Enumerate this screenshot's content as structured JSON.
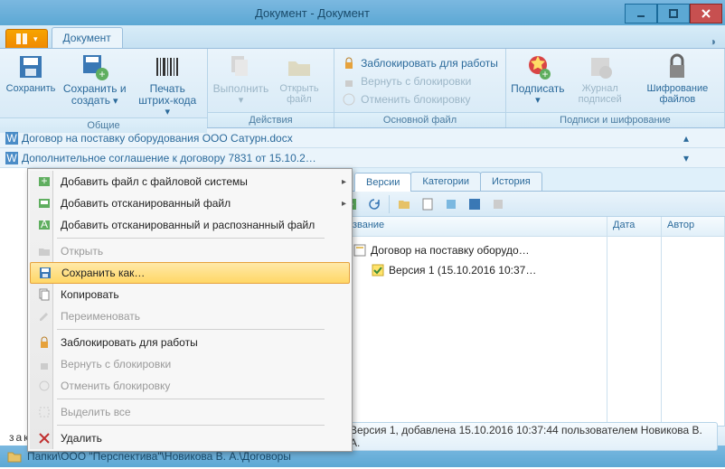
{
  "window": {
    "title": "Документ - Документ"
  },
  "menu": {
    "box": "",
    "doc_tab": "Документ"
  },
  "ribbon": {
    "group_general": "Общие",
    "group_actions": "Действия",
    "group_mainfile": "Основной файл",
    "group_signs": "Подписи и шифрование",
    "save": "Сохранить",
    "save_create": "Сохранить\nи создать",
    "barcode": "Печать\nштрих-кода",
    "execute": "Выполнить",
    "openfile": "Открыть\nфайл",
    "lockwork": "Заблокировать для работы",
    "unlock": "Вернуть с блокировки",
    "cancel_lock": "Отменить блокировку",
    "sign": "Подписать",
    "signlog": "Журнал\nподписей",
    "encrypt": "Шифрование\nфайлов"
  },
  "doc_rows": {
    "file1": "Договор на поставку оборудования ООО Сатурн.docx",
    "file2": "Дополнительное соглашение к договору 7831 от 15.10.2…"
  },
  "context": {
    "add_fs": "Добавить файл с файловой системы",
    "add_scan": "Добавить отсканированный файл",
    "add_scan_ocr": "Добавить отсканированный и распознанный файл",
    "open": "Открыть",
    "save_as": "Сохранить как…",
    "copy": "Копировать",
    "rename": "Переименовать",
    "lock": "Заблокировать для работы",
    "return_lock": "Вернуть с блокировки",
    "cancel_lock": "Отменить блокировку",
    "select_all": "Выделить все",
    "delete": "Удалить"
  },
  "doc_bottom": "заключили   настоящий   договор   о",
  "right": {
    "tab_versions": "Версии",
    "tab_categories": "Категории",
    "tab_history": "История",
    "col_name": "Название",
    "col_date": "Дата",
    "col_author": "Автор",
    "tree_root": "Договор на поставку оборудо…",
    "tree_v1": "Версия 1 (15.10.2016 10:37…",
    "status": "Версия 1, добавлена 15.10.2016 10:37:44 пользователем Новикова В. А."
  },
  "path": "Папки\\ООО \"Перспектива\"\\Новикова В. А.\\Договоры"
}
